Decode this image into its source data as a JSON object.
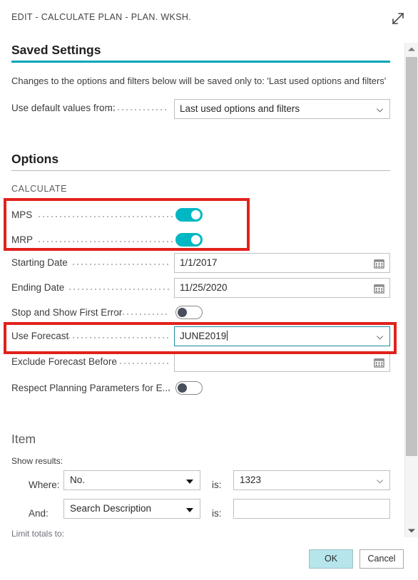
{
  "window": {
    "title": "EDIT - CALCULATE PLAN - PLAN. WKSH.",
    "expand_icon": "expand-diagonal-icon"
  },
  "saved_settings": {
    "heading": "Saved Settings",
    "note": "Changes to the options and filters below will be saved only to: 'Last used options and filters'",
    "default_values_label": "Use default values from:",
    "default_values_value": "Last used options and filters",
    "default_values_icon": "chevron-down-icon"
  },
  "options": {
    "heading": "Options",
    "group_label": "CALCULATE",
    "rows": {
      "mps": {
        "label": "MPS",
        "state": "on"
      },
      "mrp": {
        "label": "MRP",
        "state": "on"
      },
      "starting_date": {
        "label": "Starting Date",
        "value": "1/1/2017",
        "icon": "calendar-icon"
      },
      "ending_date": {
        "label": "Ending Date",
        "value": "11/25/2020",
        "icon": "calendar-icon"
      },
      "stop_show_first_error": {
        "label": "Stop and Show First Error",
        "state": "off"
      },
      "use_forecast": {
        "label": "Use Forecast",
        "value": "JUNE2019",
        "icon": "chevron-down-icon"
      },
      "exclude_forecast_before": {
        "label": "Exclude Forecast Before",
        "value": "",
        "icon": "calendar-icon"
      },
      "respect_planning_parameters": {
        "label": "Respect Planning Parameters for E...",
        "state": "off"
      }
    }
  },
  "item": {
    "heading": "Item",
    "show_results_label": "Show results:",
    "limit_totals_label": "Limit totals to:",
    "filters": [
      {
        "conjunction": "Where:",
        "field": "No.",
        "operator": "is:",
        "value": "1323",
        "value_icon": "chevron-down-icon"
      },
      {
        "conjunction": "And:",
        "field": "Search Description",
        "operator": "is:",
        "value": "",
        "value_icon": ""
      }
    ]
  },
  "footer": {
    "ok_label": "OK",
    "cancel_label": "Cancel"
  },
  "scrollbar": {
    "up_icon": "caret-up-icon",
    "down_icon": "caret-down-icon"
  },
  "colors": {
    "accent_teal": "#00a5b5",
    "toggle_on": "#00b7c3",
    "highlight_red": "#e2211c",
    "ok_button": "#b6e5ec"
  }
}
